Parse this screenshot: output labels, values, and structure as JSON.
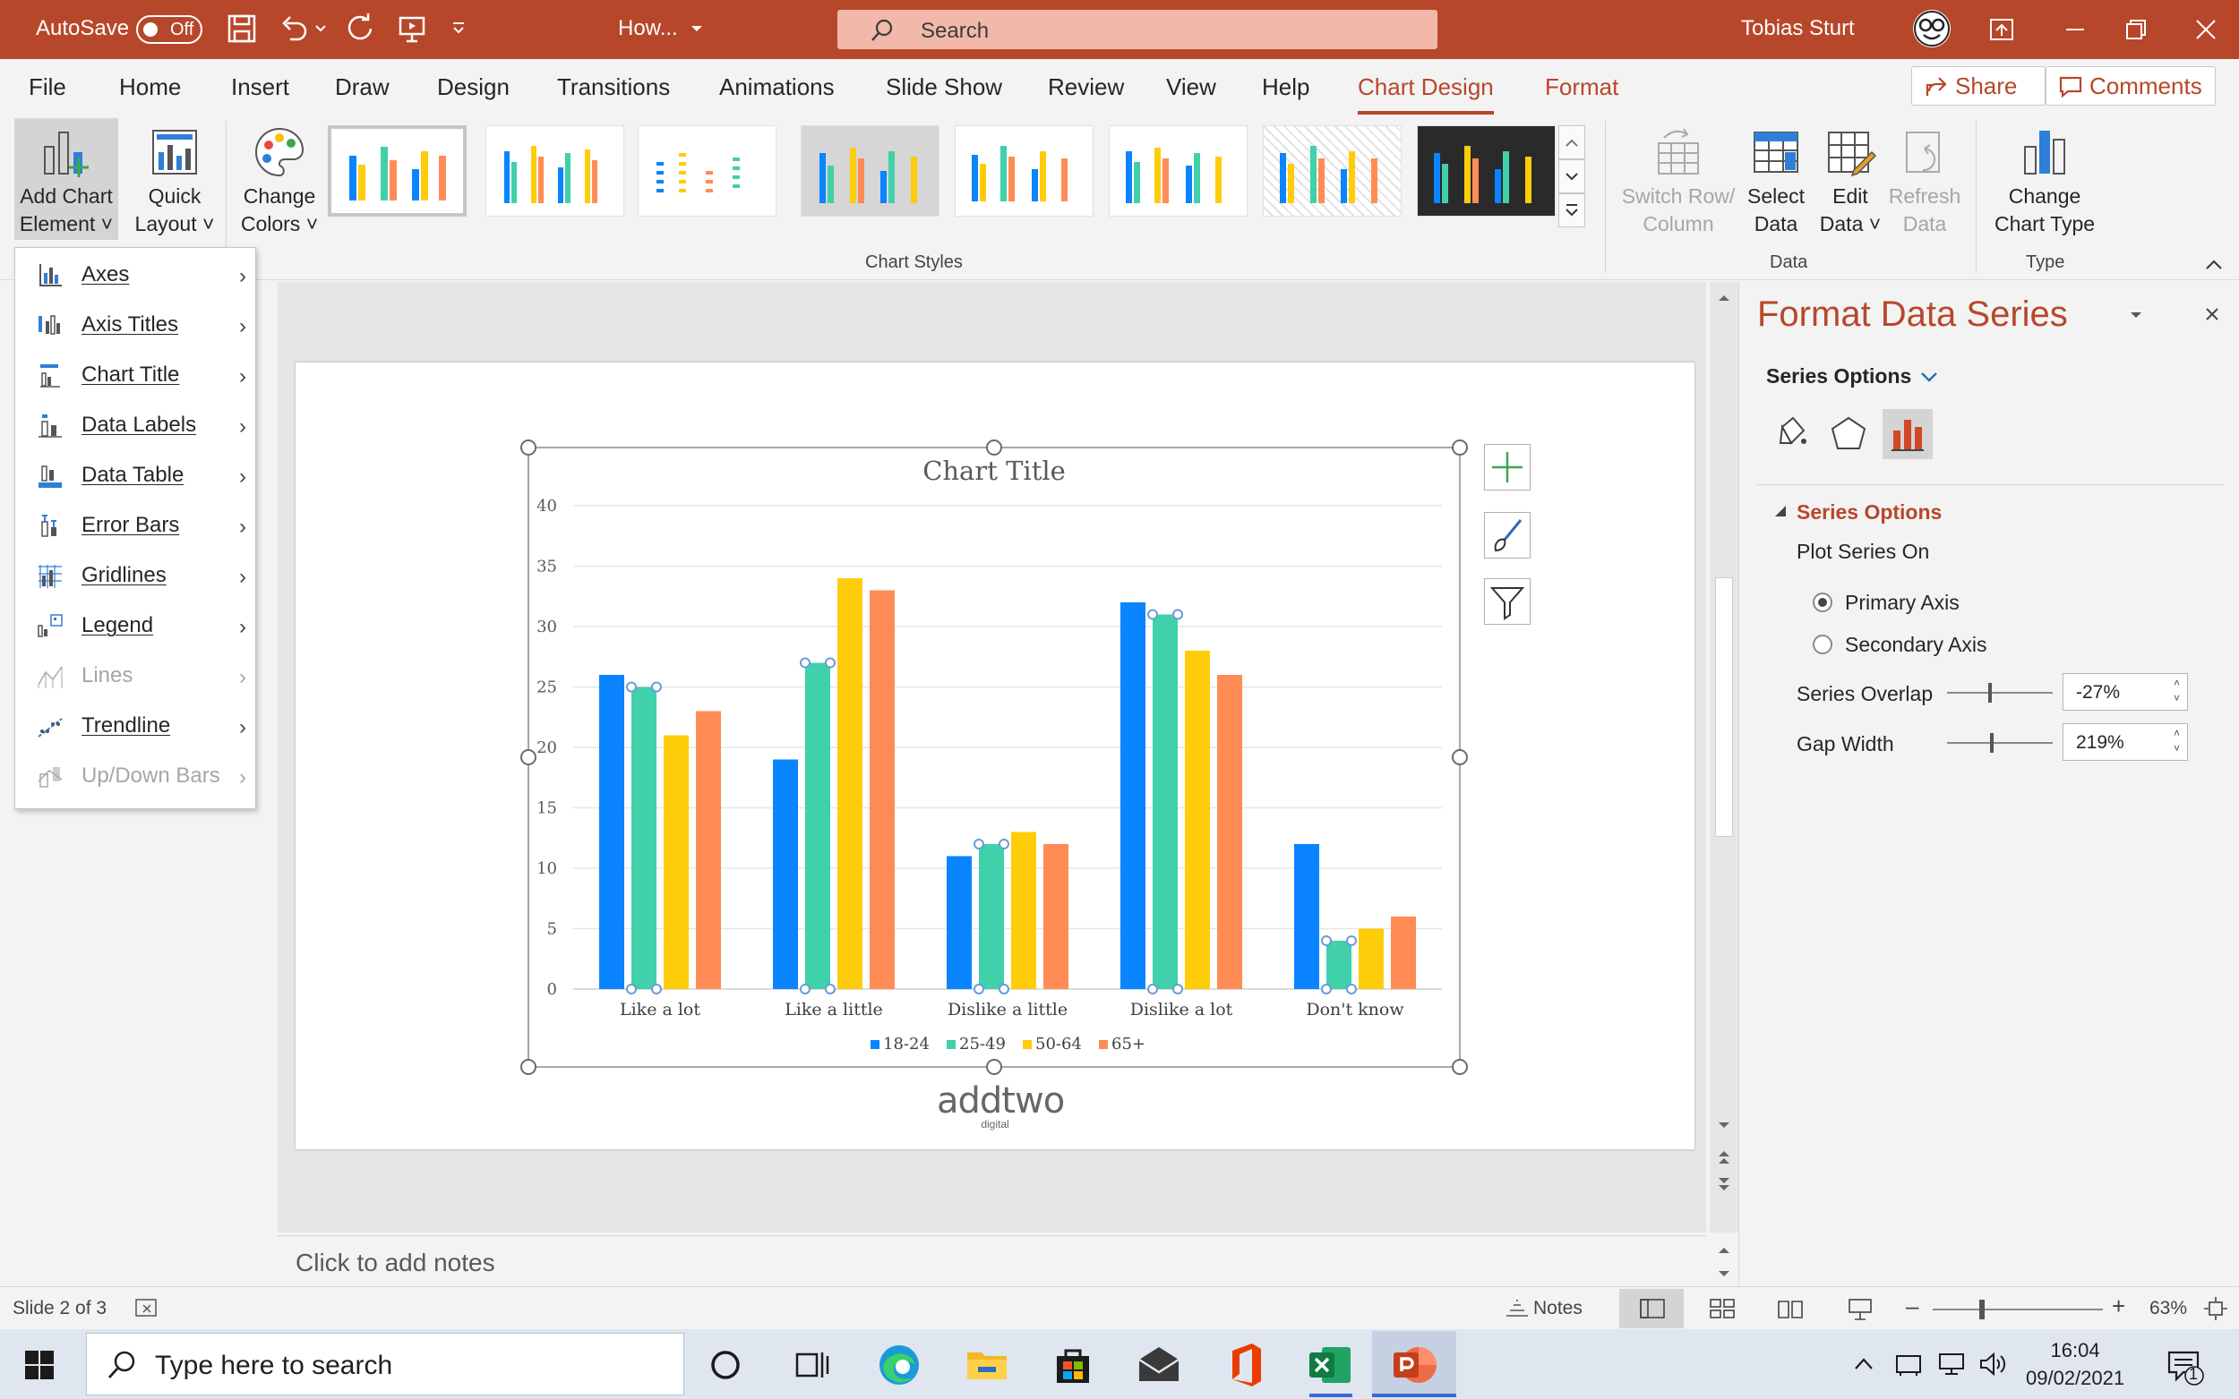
{
  "titlebar": {
    "autosave_label": "AutoSave",
    "autosave_state": "Off",
    "doc_title": "How...",
    "search_placeholder": "Search",
    "user_name": "Tobias Sturt"
  },
  "tabs": [
    {
      "label": "File"
    },
    {
      "label": "Home"
    },
    {
      "label": "Insert"
    },
    {
      "label": "Draw"
    },
    {
      "label": "Design"
    },
    {
      "label": "Transitions"
    },
    {
      "label": "Animations"
    },
    {
      "label": "Slide Show"
    },
    {
      "label": "Review"
    },
    {
      "label": "View"
    },
    {
      "label": "Help"
    },
    {
      "label": "Chart Design"
    },
    {
      "label": "Format"
    }
  ],
  "share_label": "Share",
  "comments_label": "Comments",
  "ribbon": {
    "add_chart_element": [
      "Add Chart",
      "Element"
    ],
    "quick_layout": [
      "Quick",
      "Layout"
    ],
    "change_colors": [
      "Change",
      "Colors"
    ],
    "chart_styles_group": "Chart Styles",
    "switch_row_col": [
      "Switch Row/",
      "Column"
    ],
    "select_data": [
      "Select",
      "Data"
    ],
    "edit_data": [
      "Edit",
      "Data"
    ],
    "refresh_data": [
      "Refresh",
      "Data"
    ],
    "data_group": "Data",
    "change_chart_type": [
      "Change",
      "Chart Type"
    ],
    "type_group": "Type"
  },
  "menu": {
    "items": [
      {
        "label": "Axes",
        "enabled": true
      },
      {
        "label": "Axis Titles",
        "enabled": true
      },
      {
        "label": "Chart Title",
        "enabled": true
      },
      {
        "label": "Data Labels",
        "enabled": true
      },
      {
        "label": "Data Table",
        "enabled": true
      },
      {
        "label": "Error Bars",
        "enabled": true
      },
      {
        "label": "Gridlines",
        "enabled": true
      },
      {
        "label": "Legend",
        "enabled": true
      },
      {
        "label": "Lines",
        "enabled": false
      },
      {
        "label": "Trendline",
        "enabled": true
      },
      {
        "label": "Up/Down Bars",
        "enabled": false
      }
    ]
  },
  "chart_data": {
    "type": "bar",
    "title": "Chart Title",
    "categories": [
      "Like a lot",
      "Like a little",
      "Dislike a little",
      "Dislike a lot",
      "Don't know"
    ],
    "series": [
      {
        "name": "18-24",
        "color": "#0a84ff",
        "values": [
          26,
          19,
          11,
          32,
          12
        ]
      },
      {
        "name": "25-49",
        "color": "#40d0aa",
        "values": [
          25,
          27,
          12,
          31,
          4
        ]
      },
      {
        "name": "50-64",
        "color": "#ffcc0a",
        "values": [
          21,
          34,
          13,
          28,
          5
        ]
      },
      {
        "name": "65+",
        "color": "#ff8c55",
        "values": [
          23,
          33,
          12,
          26,
          6
        ]
      }
    ],
    "ylim": [
      0,
      40
    ],
    "yticks": [
      0,
      5,
      10,
      15,
      20,
      25,
      30,
      35,
      40
    ],
    "grid": true,
    "legend": "bottom",
    "selected_series": "25-49"
  },
  "slide_logo": {
    "main": "addtwo",
    "sub": "digital"
  },
  "notes_placeholder": "Click to add notes",
  "pane": {
    "title": "Format Data Series",
    "series_options_dropdown": "Series Options",
    "section_title": "Series Options",
    "plot_series_on": "Plot Series On",
    "primary_axis": "Primary Axis",
    "secondary_axis": "Secondary Axis",
    "series_overlap_label": "Series Overlap",
    "series_overlap_value": "-27%",
    "gap_width_label": "Gap Width",
    "gap_width_value": "219%"
  },
  "status": {
    "slide_info": "Slide 2 of 3",
    "notes_label": "Notes",
    "zoom": "63%"
  },
  "taskbar": {
    "search_placeholder": "Type here to search",
    "time": "16:04",
    "date": "09/02/2021",
    "notification_count": "1"
  },
  "colors": {
    "accent": "#b7472a",
    "ribbon_bg": "#f3f3f3"
  }
}
